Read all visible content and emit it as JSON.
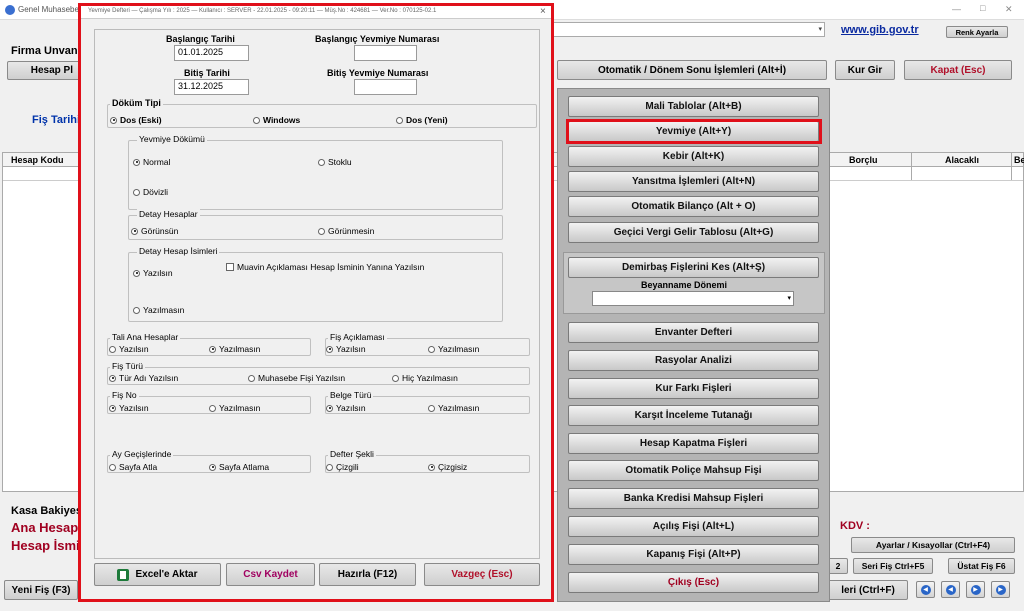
{
  "main_window": {
    "title": "Genel Muhasebe",
    "website": "www.gib.gov.tr",
    "renk_ayarla": "Renk Ayarla",
    "firma_label": "Firma Unvanı",
    "hesap_plani_button": "Hesap Pl",
    "otomatik_donem_button": "Otomatik / Dönem Sonu İşlemleri (Alt+İ)",
    "kur_gir_button": "Kur Gir",
    "kapat_button": "Kapat (Esc)",
    "fis_tarihi_label": "Fiş Tarihi",
    "table_headers": {
      "hesap_kodu": "Hesap Kodu",
      "borclu": "Borçlu",
      "alacakli": "Alacaklı",
      "extra": "Be"
    },
    "kasa_bakiyesi": "Kasa Bakiyes",
    "ana_hesap": "Ana Hesap",
    "hesap_ismi": "Hesap İsmi",
    "kdv_label": "KDV :",
    "ayarlar_button": "Ayarlar / Kısayollar (Ctrl+F4)",
    "partial_2_button": "2",
    "seri_fis_button": "Seri Fiş Ctrl+F5",
    "ustat_fis_button": "Üstat Fiş F6",
    "yeni_fis_button": "Yeni Fiş (F3)",
    "ctrl_f_button": "leri (Ctrl+F)",
    "window_controls": {
      "min": "—",
      "max": "□",
      "close": "✕"
    }
  },
  "dialog": {
    "title": "Yevmiye Defteri  —  Çalışma Yılı : 2025  —  Kullanıcı : SERVER - 22.01.2025 - 09:20:11  —  Müş.No : 424681  —  Ver.No : 070125-02.1",
    "close": "×",
    "baslangic_tarihi_label": "Başlangıç Tarihi",
    "baslangic_tarihi_value": "01.01.2025",
    "baslangic_yevmiye_label": "Başlangıç Yevmiye Numarası",
    "baslangic_yevmiye_value": "",
    "bitis_tarihi_label": "Bitiş Tarihi",
    "bitis_tarihi_value": "31.12.2025",
    "bitis_yevmiye_label": "Bitiş Yevmiye Numarası",
    "bitis_yevmiye_value": "",
    "dokum_tipi": {
      "title": "Döküm Tipi",
      "options": [
        "Dos (Eski)",
        "Windows",
        "Dos (Yeni)"
      ],
      "selected": 0
    },
    "yevmiye_dokumu": {
      "title": "Yevmiye Dökümü",
      "options": [
        "Normal",
        "Stoklu",
        "Dövizli"
      ],
      "selected": 0
    },
    "detay_hesaplar": {
      "title": "Detay Hesaplar",
      "options": [
        "Görünsün",
        "Görünmesin"
      ],
      "selected": 0
    },
    "detay_hesap_isimleri": {
      "title": "Detay Hesap İsimleri",
      "options": [
        "Yazılsın",
        "Yazılmasın"
      ],
      "selected": 0,
      "checkbox": "Muavin Açıklaması Hesap İsminin Yanına Yazılsın"
    },
    "tali_ana_hesaplar": {
      "title": "Tali Ana Hesaplar",
      "options": [
        "Yazılsın",
        "Yazılmasın"
      ],
      "selected": 1
    },
    "fis_aciklamasi": {
      "title": "Fiş Açıklaması",
      "options": [
        "Yazılsın",
        "Yazılmasın"
      ],
      "selected": 0
    },
    "fis_turu": {
      "title": "Fiş Türü",
      "options": [
        "Tür Adı Yazılsın",
        "Muhasebe Fişi Yazılsın",
        "Hiç Yazılmasın"
      ],
      "selected": 0
    },
    "fis_no": {
      "title": "Fiş No",
      "options": [
        "Yazılsın",
        "Yazılmasın"
      ],
      "selected": 0
    },
    "belge_turu": {
      "title": "Belge Türü",
      "options": [
        "Yazılsın",
        "Yazılmasın"
      ],
      "selected": 0
    },
    "ay_gecislerinde": {
      "title": "Ay Geçişlerinde",
      "options": [
        "Sayfa Atla",
        "Sayfa Atlama"
      ],
      "selected": 1
    },
    "defter_sekli": {
      "title": "Defter Şekli",
      "options": [
        "Çizgili",
        "Çizgisiz"
      ],
      "selected": 1
    },
    "buttons": {
      "excel": "Excel'e Aktar",
      "csv": "Csv Kaydet",
      "hazirla": "Hazırla (F12)",
      "vazgec": "Vazgeç (Esc)"
    }
  },
  "right_menu": {
    "items_top": [
      "Mali Tablolar (Alt+B)",
      "Yevmiye (Alt+Y)",
      "Kebir (Alt+K)",
      "Yansıtma İşlemleri (Alt+N)",
      "Otomatik Bilanço (Alt + O)",
      "Geçici Vergi Gelir Tablosu (Alt+G)"
    ],
    "demirbas": "Demirbaş Fişlerini Kes (Alt+Ş)",
    "beyanname_label": "Beyanname Dönemi",
    "beyanname_value": "",
    "items_bottom": [
      "Envanter Defteri",
      "Rasyolar Analizi",
      "Kur Farkı Fişleri",
      "Karşıt İnceleme Tutanağı",
      "Hesap Kapatma Fişleri",
      "Otomatik Poliçe Mahsup Fişi",
      "Banka Kredisi Mahsup Fişleri",
      "Açılış Fişi (Alt+L)",
      "Kapanış Fişi (Alt+P)",
      "Çıkış (Esc)"
    ]
  },
  "colors": {
    "highlight_red": "#e0101a",
    "title_blue": "#0033aa",
    "dark_red": "#a00020"
  }
}
